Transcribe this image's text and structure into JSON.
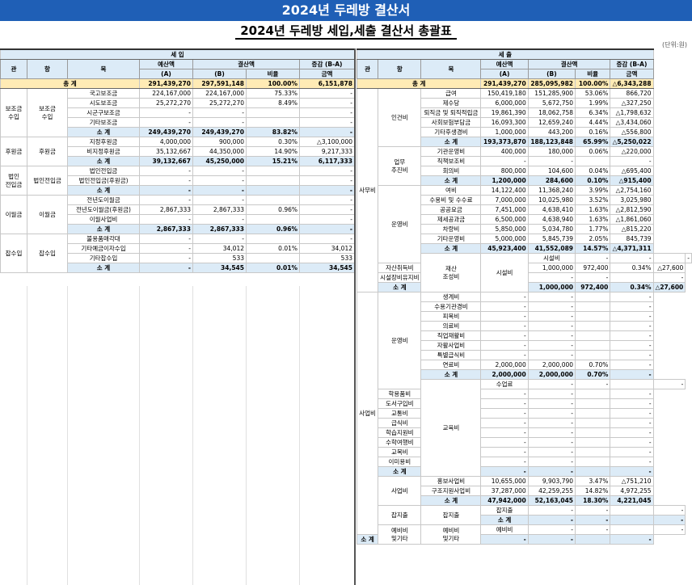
{
  "window_title": "2024년 두레방 결산서",
  "doc_title": "2024년 두레방 세입,세출 결산서 총괄표",
  "unit": "(단위:원)",
  "left": {
    "section": "세 입",
    "headers": {
      "gwan": "관",
      "hang": "항",
      "mok": "목",
      "budget": "예산액",
      "budget_sub": "(A)",
      "settle": "결산액",
      "settle_sub": "(B)",
      "ratio": "비율",
      "diff": "증감 (B-A)",
      "diff_sub": "금액"
    },
    "total": {
      "label": "총 계",
      "budget": "291,439,270",
      "settle": "297,591,148",
      "ratio": "100.00%",
      "diff": "6,151,878"
    },
    "groups": [
      {
        "gwan": "보조금\n수입",
        "hang": "보조금\n수입",
        "rows": [
          {
            "mok": "국고보조금",
            "budget": "224,167,000",
            "settle": "224,167,000",
            "ratio": "75.33%",
            "diff": "-"
          },
          {
            "mok": "시도보조금",
            "budget": "25,272,270",
            "settle": "25,272,270",
            "ratio": "8.49%",
            "diff": "-"
          },
          {
            "mok": "시군구보조금",
            "budget": "-",
            "settle": "-",
            "ratio": "",
            "diff": "-"
          },
          {
            "mok": "기타보조금",
            "budget": "-",
            "settle": "-",
            "ratio": "",
            "diff": "-"
          }
        ],
        "sub": {
          "label": "소 계",
          "budget": "249,439,270",
          "settle": "249,439,270",
          "ratio": "83.82%",
          "diff": "-"
        }
      },
      {
        "gwan": "후원금",
        "hang": "후원금",
        "rows": [
          {
            "mok": "지정후원금",
            "budget": "4,000,000",
            "settle": "900,000",
            "ratio": "0.30%",
            "diff": "△3,100,000"
          },
          {
            "mok": "비지정후원금",
            "budget": "35,132,667",
            "settle": "44,350,000",
            "ratio": "14.90%",
            "diff": "9,217,333"
          }
        ],
        "sub": {
          "label": "소 계",
          "budget": "39,132,667",
          "settle": "45,250,000",
          "ratio": "15.21%",
          "diff": "6,117,333"
        }
      },
      {
        "gwan": "법인\n전입금",
        "hang": "법인전입금",
        "rows": [
          {
            "mok": "법인전입금",
            "budget": "-",
            "settle": "-",
            "ratio": "",
            "diff": "-"
          },
          {
            "mok": "법인전입금(후원금)",
            "budget": "-",
            "settle": "-",
            "ratio": "",
            "diff": "-"
          }
        ],
        "sub": {
          "label": "소 계",
          "budget": "-",
          "settle": "-",
          "ratio": "",
          "diff": "-"
        }
      },
      {
        "gwan": "이월금",
        "hang": "이월금",
        "rows": [
          {
            "mok": "전년도이월금",
            "budget": "-",
            "settle": "-",
            "ratio": "",
            "diff": "-"
          },
          {
            "mok": "전년도이월금(후원금)",
            "budget": "2,867,333",
            "settle": "2,867,333",
            "ratio": "0.96%",
            "diff": "-"
          },
          {
            "mok": "이월사업비",
            "budget": "-",
            "settle": "-",
            "ratio": "",
            "diff": "-"
          }
        ],
        "sub": {
          "label": "소 계",
          "budget": "2,867,333",
          "settle": "2,867,333",
          "ratio": "0.96%",
          "diff": "-"
        }
      },
      {
        "gwan": "잡수입",
        "hang": "잡수입",
        "rows": [
          {
            "mok": "불용품매각대",
            "budget": "-",
            "settle": "-",
            "ratio": "",
            "diff": "-"
          },
          {
            "mok": "기타예금이자수입",
            "budget": "-",
            "settle": "34,012",
            "ratio": "0.01%",
            "diff": "34,012"
          },
          {
            "mok": "기타잡수입",
            "budget": "-",
            "settle": "533",
            "ratio": "",
            "diff": "533"
          }
        ],
        "sub": {
          "label": "소 계",
          "budget": "-",
          "settle": "34,545",
          "ratio": "0.01%",
          "diff": "34,545"
        }
      }
    ]
  },
  "right": {
    "section": "세 출",
    "headers": {
      "gwan": "관",
      "hang": "항",
      "mok": "목",
      "budget": "예산액",
      "budget_sub": "(A)",
      "settle": "결산액",
      "settle_sub": "(B)",
      "ratio": "비율",
      "diff": "증감 (B-A)",
      "diff_sub": "금액"
    },
    "total": {
      "label": "총 계",
      "budget": "291,439,270",
      "settle": "285,095,982",
      "ratio": "100.00%",
      "diff": "△6,343,288"
    },
    "rows": [
      {
        "gwan": "사무비",
        "gspan": 21,
        "hang": "인건비",
        "hspan": 6,
        "mok": "급여",
        "budget": "150,419,180",
        "settle": "151,285,900",
        "ratio": "53.06%",
        "diff": "866,720"
      },
      {
        "mok": "제수당",
        "budget": "6,000,000",
        "settle": "5,672,750",
        "ratio": "1.99%",
        "diff": "△327,250"
      },
      {
        "mok": "퇴직금 및 퇴직적립금",
        "budget": "19,861,390",
        "settle": "18,062,758",
        "ratio": "6.34%",
        "diff": "△1,798,632"
      },
      {
        "mok": "사회보험부담금",
        "budget": "16,093,300",
        "settle": "12,659,240",
        "ratio": "4.44%",
        "diff": "△3,434,060"
      },
      {
        "mok": "기타후생경비",
        "budget": "1,000,000",
        "settle": "443,200",
        "ratio": "0.16%",
        "diff": "△556,800"
      },
      {
        "sub": true,
        "mok": "소 계",
        "budget": "193,373,870",
        "settle": "188,123,848",
        "ratio": "65.99%",
        "diff": "△5,250,022"
      },
      {
        "hang": "업무\n추진비",
        "hspan": 4,
        "mok": "기관운영비",
        "budget": "400,000",
        "settle": "180,000",
        "ratio": "0.06%",
        "diff": "△220,000"
      },
      {
        "mok": "직책보조비",
        "budget": "-",
        "settle": "-",
        "ratio": "",
        "diff": "-"
      },
      {
        "mok": "회의비",
        "budget": "800,000",
        "settle": "104,600",
        "ratio": "0.04%",
        "diff": "△695,400"
      },
      {
        "sub": true,
        "mok": "소 계",
        "budget": "1,200,000",
        "settle": "284,600",
        "ratio": "0.10%",
        "diff": "△915,400"
      },
      {
        "hang": "운영비",
        "hspan": 8,
        "mok": "여비",
        "budget": "14,122,400",
        "settle": "11,368,240",
        "ratio": "3.99%",
        "diff": "△2,754,160"
      },
      {
        "mok": "수용비 및 수수료",
        "budget": "7,000,000",
        "settle": "10,025,980",
        "ratio": "3.52%",
        "diff": "3,025,980"
      },
      {
        "mok": "공공요금",
        "budget": "7,451,000",
        "settle": "4,638,410",
        "ratio": "1.63%",
        "diff": "△2,812,590"
      },
      {
        "mok": "제세공과금",
        "budget": "6,500,000",
        "settle": "4,638,940",
        "ratio": "1.63%",
        "diff": "△1,861,060"
      },
      {
        "mok": "차량비",
        "budget": "5,850,000",
        "settle": "5,034,780",
        "ratio": "1.77%",
        "diff": "△815,220"
      },
      {
        "mok": "기타운영비",
        "budget": "5,000,000",
        "settle": "5,845,739",
        "ratio": "2.05%",
        "diff": "845,739"
      },
      {
        "sub": true,
        "mok": "소 계",
        "budget": "45,923,400",
        "settle": "41,552,089",
        "ratio": "14.57%",
        "diff": "△4,371,311"
      },
      {
        "gwan": "재산\n조성비",
        "gspan": 4,
        "hang": "시설비",
        "hspan": 4,
        "mok": "시설비",
        "budget": "-",
        "settle": "-",
        "ratio": "",
        "diff": "-"
      },
      {
        "mok": "자산취득비",
        "budget": "1,000,000",
        "settle": "972,400",
        "ratio": "0.34%",
        "diff": "△27,600"
      },
      {
        "mok": "시설장비유지비",
        "budget": "-",
        "settle": "-",
        "ratio": "",
        "diff": "-"
      },
      {
        "sub": true,
        "mok": "소 계",
        "budget": "1,000,000",
        "settle": "972,400",
        "ratio": "0.34%",
        "diff": "△27,600"
      },
      {
        "gwan": "사업비",
        "gspan": 25,
        "hang": "운영비",
        "hspan": 10,
        "mok": "생계비",
        "budget": "-",
        "settle": "-",
        "ratio": "",
        "diff": "-"
      },
      {
        "mok": "수용기관경비",
        "budget": "-",
        "settle": "-",
        "ratio": "",
        "diff": "-"
      },
      {
        "mok": "피복비",
        "budget": "-",
        "settle": "-",
        "ratio": "",
        "diff": "-"
      },
      {
        "mok": "의료비",
        "budget": "-",
        "settle": "-",
        "ratio": "",
        "diff": "-"
      },
      {
        "mok": "직업재활비",
        "budget": "-",
        "settle": "-",
        "ratio": "",
        "diff": "-"
      },
      {
        "mok": "자활사업비",
        "budget": "-",
        "settle": "-",
        "ratio": "",
        "diff": "-"
      },
      {
        "mok": "특별급식비",
        "budget": "-",
        "settle": "-",
        "ratio": "",
        "diff": "-"
      },
      {
        "mok": "연료비",
        "budget": "2,000,000",
        "settle": "2,000,000",
        "ratio": "0.70%",
        "diff": "-"
      },
      {
        "sub": true,
        "mok": "소 계",
        "budget": "2,000,000",
        "settle": "2,000,000",
        "ratio": "0.70%",
        "diff": "-"
      },
      {
        "hang": "교육비",
        "hspan": 10,
        "mok": "수업료",
        "budget": "-",
        "settle": "-",
        "ratio": "",
        "diff": "-"
      },
      {
        "mok": "학용품비",
        "budget": "-",
        "settle": "-",
        "ratio": "",
        "diff": "-"
      },
      {
        "mok": "도서구입비",
        "budget": "-",
        "settle": "-",
        "ratio": "",
        "diff": "-"
      },
      {
        "mok": "교통비",
        "budget": "-",
        "settle": "-",
        "ratio": "",
        "diff": "-"
      },
      {
        "mok": "급식비",
        "budget": "-",
        "settle": "-",
        "ratio": "",
        "diff": "-"
      },
      {
        "mok": "학습지원비",
        "budget": "-",
        "settle": "-",
        "ratio": "",
        "diff": "-"
      },
      {
        "mok": "수학여행비",
        "budget": "-",
        "settle": "-",
        "ratio": "",
        "diff": "-"
      },
      {
        "mok": "교복비",
        "budget": "-",
        "settle": "-",
        "ratio": "",
        "diff": "-"
      },
      {
        "mok": "이미용비",
        "budget": "-",
        "settle": "-",
        "ratio": "",
        "diff": "-"
      },
      {
        "sub": true,
        "mok": "소 계",
        "budget": "-",
        "settle": "-",
        "ratio": "",
        "diff": "-"
      },
      {
        "hang": "사업비",
        "hspan": 3,
        "mok": "홍보사업비",
        "budget": "10,655,000",
        "settle": "9,903,790",
        "ratio": "3.47%",
        "diff": "△751,210"
      },
      {
        "mok": "구조지원사업비",
        "budget": "37,287,000",
        "settle": "42,259,255",
        "ratio": "14.82%",
        "diff": "4,972,255"
      },
      {
        "sub": true,
        "mok": "소 계",
        "budget": "47,942,000",
        "settle": "52,163,045",
        "ratio": "18.30%",
        "diff": "4,221,045"
      },
      {
        "gwan": "잡지출",
        "gspan": 2,
        "hang": "잡지출",
        "hspan": 2,
        "mok": "잡지출",
        "budget": "-",
        "settle": "-",
        "ratio": "",
        "diff": "-"
      },
      {
        "sub": true,
        "mok": "소 계",
        "budget": "-",
        "settle": "-",
        "ratio": "",
        "diff": "-"
      },
      {
        "gwan": "예비비\n및기타",
        "gspan": 2,
        "hang": "예비비\n및기타",
        "hspan": 2,
        "mok": "예비비",
        "budget": "-",
        "settle": "-",
        "ratio": "",
        "diff": "-"
      },
      {
        "sub": true,
        "mok": "소 계",
        "budget": "-",
        "settle": "-",
        "ratio": "",
        "diff": "-"
      }
    ]
  }
}
